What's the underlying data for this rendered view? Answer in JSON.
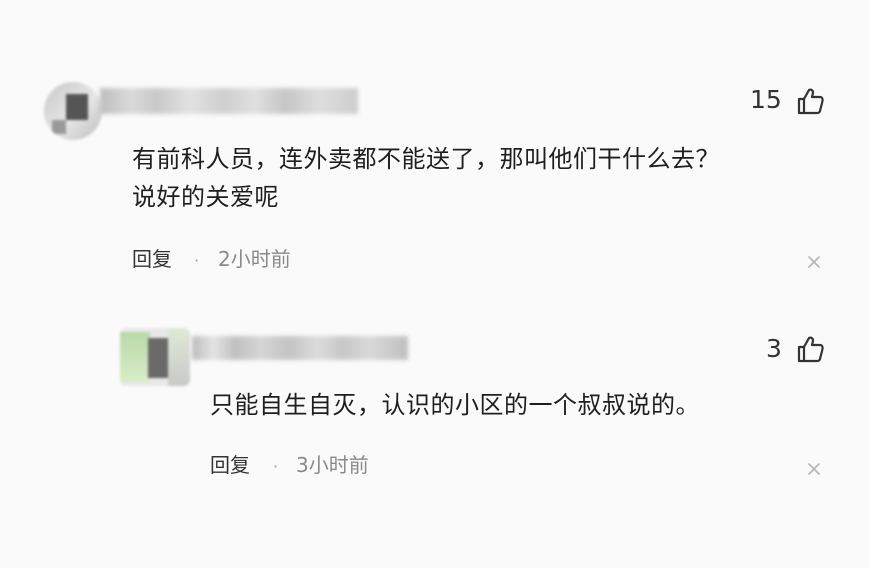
{
  "comments": [
    {
      "likes": "15",
      "text_line1": "有前科人员，连外卖都不能送了，那叫他们干什么去？",
      "text_line2": "说好的关爱呢",
      "reply_label": "回复",
      "separator": "·",
      "time": "2小时前"
    },
    {
      "likes": "3",
      "text_line1": "只能自生自灭，认识的小区的一个叔叔说的。",
      "reply_label": "回复",
      "separator": "·",
      "time": "3小时前"
    }
  ],
  "icons": {
    "like": "thumbs-up-icon",
    "close": "close-icon"
  },
  "colors": {
    "background": "#fafafa",
    "text": "#1e1e1e",
    "muted": "#8a8a8a"
  }
}
